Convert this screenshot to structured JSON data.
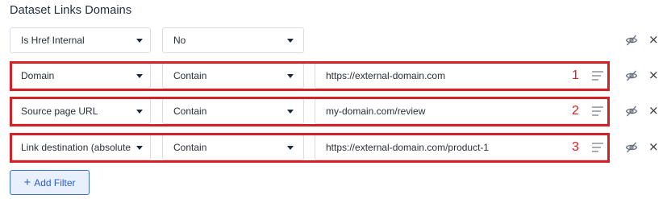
{
  "section_title": "Dataset Links Domains",
  "filters": [
    {
      "field": "Is Href Internal",
      "operator": "No",
      "value": null,
      "number": "",
      "highlighted": false
    },
    {
      "field": "Domain",
      "operator": "Contain",
      "value": "https://external-domain.com",
      "number": "1",
      "highlighted": true
    },
    {
      "field": "Source page URL",
      "operator": "Contain",
      "value": "my-domain.com/review",
      "number": "2",
      "highlighted": true
    },
    {
      "field": "Link destination (absolute",
      "operator": "Contain",
      "value": "https://external-domain.com/product-1",
      "number": "3",
      "highlighted": true
    }
  ],
  "add_filter": {
    "icon": "+",
    "label": "Add Filter"
  },
  "icons": {
    "visibility": "eye-off-icon",
    "remove": "close-icon",
    "drag": "drag-handle-icon",
    "remove_glyph": "×"
  },
  "colors": {
    "highlight": "#d61f26",
    "accent": "#2b5fcf"
  }
}
